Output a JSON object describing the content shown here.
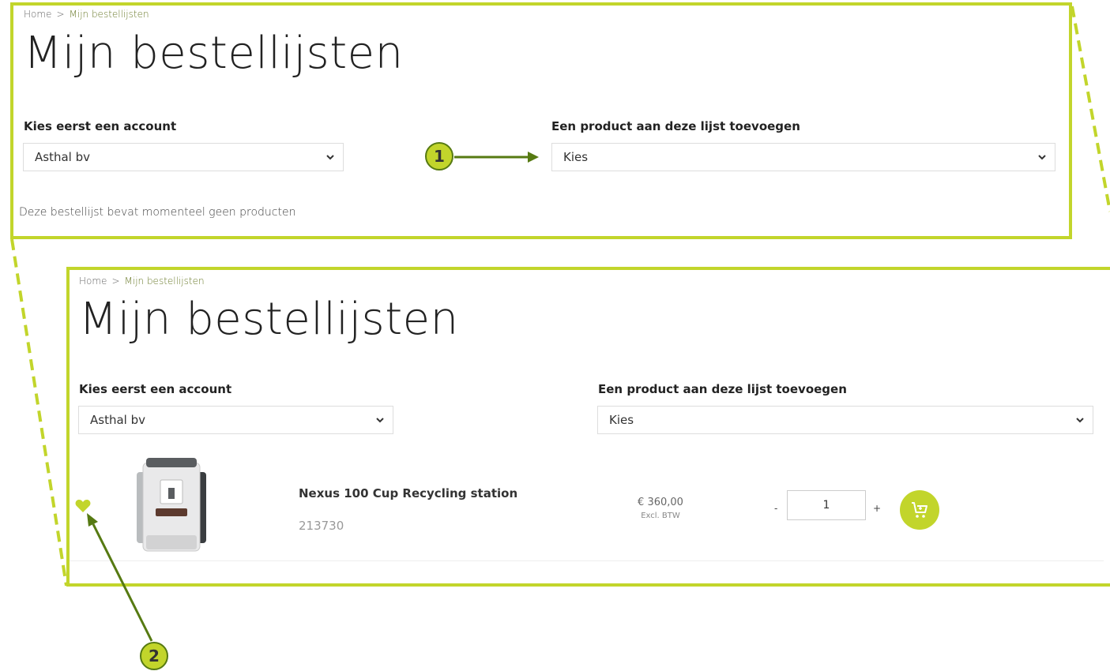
{
  "breadcrumb": {
    "home": "Home",
    "separator": ">",
    "current": "Mijn bestellijsten"
  },
  "page_title": "Mijn bestellijsten",
  "account": {
    "label": "Kies eerst een account",
    "selected": "Asthal bv"
  },
  "add_product": {
    "label": "Een product aan deze lijst toevoegen",
    "selected": "Kies"
  },
  "empty_message": "Deze bestellijst bevat momenteel geen producten",
  "product": {
    "name": "Nexus 100 Cup Recycling station",
    "sku": "213730",
    "price": "€ 360,00",
    "vat_note": "Excl. BTW",
    "qty": "1",
    "minus": "-",
    "plus": "+"
  },
  "callouts": {
    "one": "1",
    "two": "2"
  },
  "colors": {
    "accent": "#c2d52b",
    "arrow": "#567a12",
    "frame": "#c2d52b"
  },
  "icons": [
    "chevron-down-icon",
    "heart-icon",
    "cart-icon",
    "arrow-icon",
    "product-image"
  ]
}
